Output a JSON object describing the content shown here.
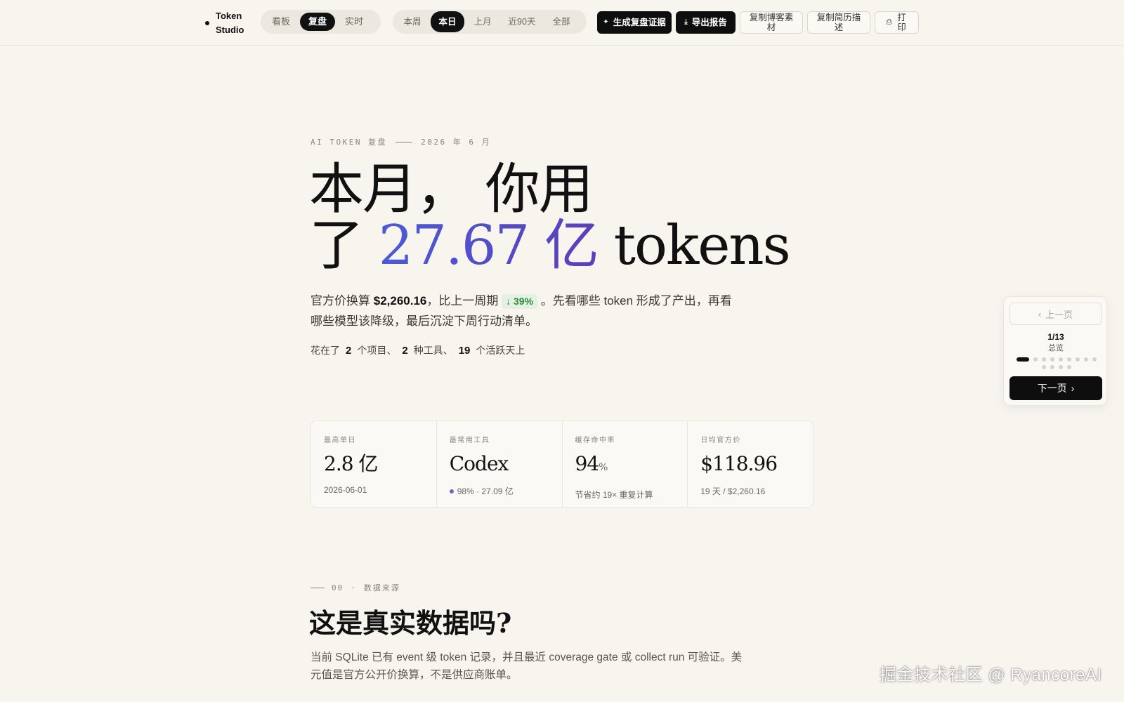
{
  "brand": {
    "name": "Token Studio"
  },
  "view_tabs": [
    {
      "label": "看板",
      "active": false
    },
    {
      "label": "复盘",
      "active": true
    },
    {
      "label": "实时",
      "active": false
    }
  ],
  "range_tabs": [
    {
      "label": "本周",
      "active": false
    },
    {
      "label": "本日",
      "active": true
    },
    {
      "label": "上月",
      "active": false
    },
    {
      "label": "近90天",
      "active": false
    },
    {
      "label": "全部",
      "active": false
    }
  ],
  "actions": {
    "generate": "生成复盘证据",
    "export": "导出报告",
    "copy_blog": "复制博客素材",
    "copy_resume": "复制简历描述",
    "print": "打印"
  },
  "hero": {
    "kicker_left": "AI TOKEN 复盘",
    "kicker_right": "2026 年 6 月",
    "headline_line1": "本月， 你用",
    "headline_pre": "了 ",
    "headline_number": "27.67 亿",
    "headline_post": " tokens",
    "lede_pre": "官方价换算 ",
    "lede_amount": "$2,260.16",
    "lede_mid": "，比上一周期 ",
    "lede_delta": "↓ 39%",
    "lede_post": " 。先看哪些 token 形成了产出，再看哪些模型该降级，最后沉淀下周行动清单。",
    "facts_pre": "花在了",
    "facts_projects": "2",
    "facts_projects_unit": "个项目、",
    "facts_tools": "2",
    "facts_tools_unit": "种工具、",
    "facts_days": "19",
    "facts_days_unit": "个活跃天上"
  },
  "stats": [
    {
      "label": "最高单日",
      "value": "2.8 亿",
      "sub": "2026-06-01"
    },
    {
      "label": "最常用工具",
      "value": "Codex",
      "sub": "98% · 27.09 亿"
    },
    {
      "label": "缓存命中率",
      "value": "94",
      "value_unit": "%",
      "sub": "节省约 19× 重复计算"
    },
    {
      "label": "日均官方价",
      "value": "$118.96",
      "sub": "19 天 / $2,260.16"
    }
  ],
  "section": {
    "number": "00",
    "name": "数据来源",
    "title": "这是真实数据吗?",
    "body": "当前 SQLite 已有 event 级 token 记录，并且最近 coverage gate 或 collect run 可验证。美元值是官方公开价换算，不是供应商账单。"
  },
  "pager": {
    "prev": "上一页",
    "count": "1/13",
    "section": "总览",
    "next": "下一页",
    "total": 13,
    "current": 1
  },
  "watermark": "掘金技术社区 @ RyancoreAI"
}
